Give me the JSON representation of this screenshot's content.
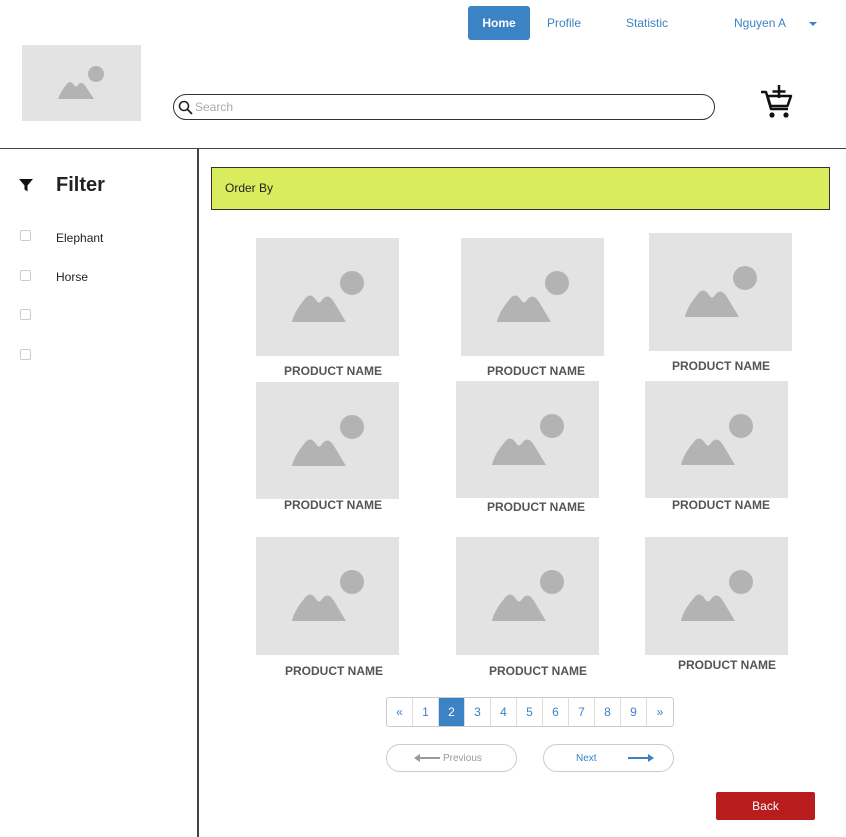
{
  "nav": {
    "home": "Home",
    "profile": "Profile",
    "statistic": "Statistic",
    "user": "Nguyen A"
  },
  "search": {
    "placeholder": "Search"
  },
  "filter": {
    "title": "Filter",
    "options": [
      "Elephant",
      "Horse",
      "",
      ""
    ]
  },
  "order_by": "Order By",
  "products": [
    {
      "name": "PRODUCT NAME"
    },
    {
      "name": "PRODUCT NAME"
    },
    {
      "name": "PRODUCT NAME"
    },
    {
      "name": "PRODUCT NAME"
    },
    {
      "name": "PRODUCT NAME"
    },
    {
      "name": "PRODUCT NAME"
    },
    {
      "name": "PRODUCT NAME"
    },
    {
      "name": "PRODUCT NAME"
    },
    {
      "name": "PRODUCT NAME"
    }
  ],
  "pagination": {
    "first": "«",
    "pages": [
      "1",
      "2",
      "3",
      "4",
      "5",
      "6",
      "7",
      "8",
      "9"
    ],
    "last": "»",
    "current": "2"
  },
  "previous_label": "Previous",
  "next_label": "Next",
  "back_label": "Back",
  "colors": {
    "accent": "#3c83c5",
    "order_bar": "#d9ec5d",
    "back_button": "#b81c1c",
    "placeholder_bg": "#e3e3e3"
  },
  "icons": [
    "image-placeholder-icon",
    "search-icon",
    "cart-add-icon",
    "filter-icon",
    "chevron-down-icon",
    "arrow-left-icon",
    "arrow-right-icon"
  ]
}
